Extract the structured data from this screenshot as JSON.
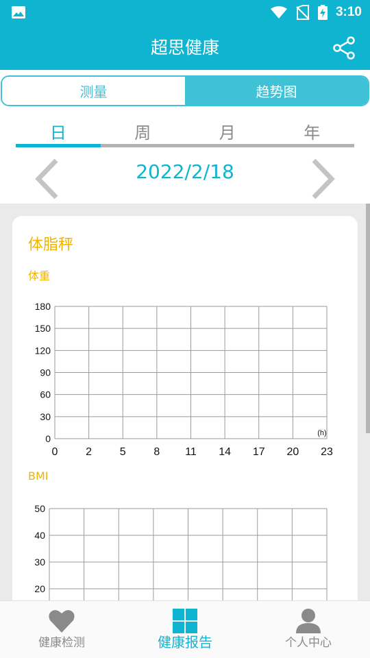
{
  "status_bar": {
    "time": "3:10"
  },
  "app_bar": {
    "title": "超思健康"
  },
  "segments": {
    "measure": "测量",
    "trend": "趋势图",
    "selected": "趋势图"
  },
  "period_tabs": {
    "day": "日",
    "week": "周",
    "month": "月",
    "year": "年",
    "selected": "日"
  },
  "date": "2022/2/18",
  "card": {
    "title": "体脂秤",
    "weight_label": "体重",
    "bmi_label": "BMI"
  },
  "chart_data": [
    {
      "type": "line",
      "title": "体重",
      "xlabel": "(h)",
      "ylabel": "",
      "x_ticks": [
        "0",
        "2",
        "5",
        "8",
        "11",
        "14",
        "17",
        "20",
        "23"
      ],
      "y_ticks": [
        "0",
        "30",
        "60",
        "90",
        "120",
        "150",
        "180"
      ],
      "xlim": [
        0,
        23
      ],
      "ylim": [
        0,
        180
      ],
      "grid": true,
      "series": []
    },
    {
      "type": "line",
      "title": "BMI",
      "xlabel": "",
      "ylabel": "",
      "y_ticks": [
        "20",
        "30",
        "40",
        "50"
      ],
      "ylim": [
        10,
        50
      ],
      "grid": true,
      "series": []
    }
  ],
  "bottom_nav": {
    "health_check": "健康检测",
    "health_report": "健康报告",
    "personal_center": "个人中心",
    "selected": "健康报告"
  },
  "colors": {
    "primary": "#0fb4d0",
    "accent": "#f0b400",
    "tab_inactive": "#8a8a8a"
  }
}
